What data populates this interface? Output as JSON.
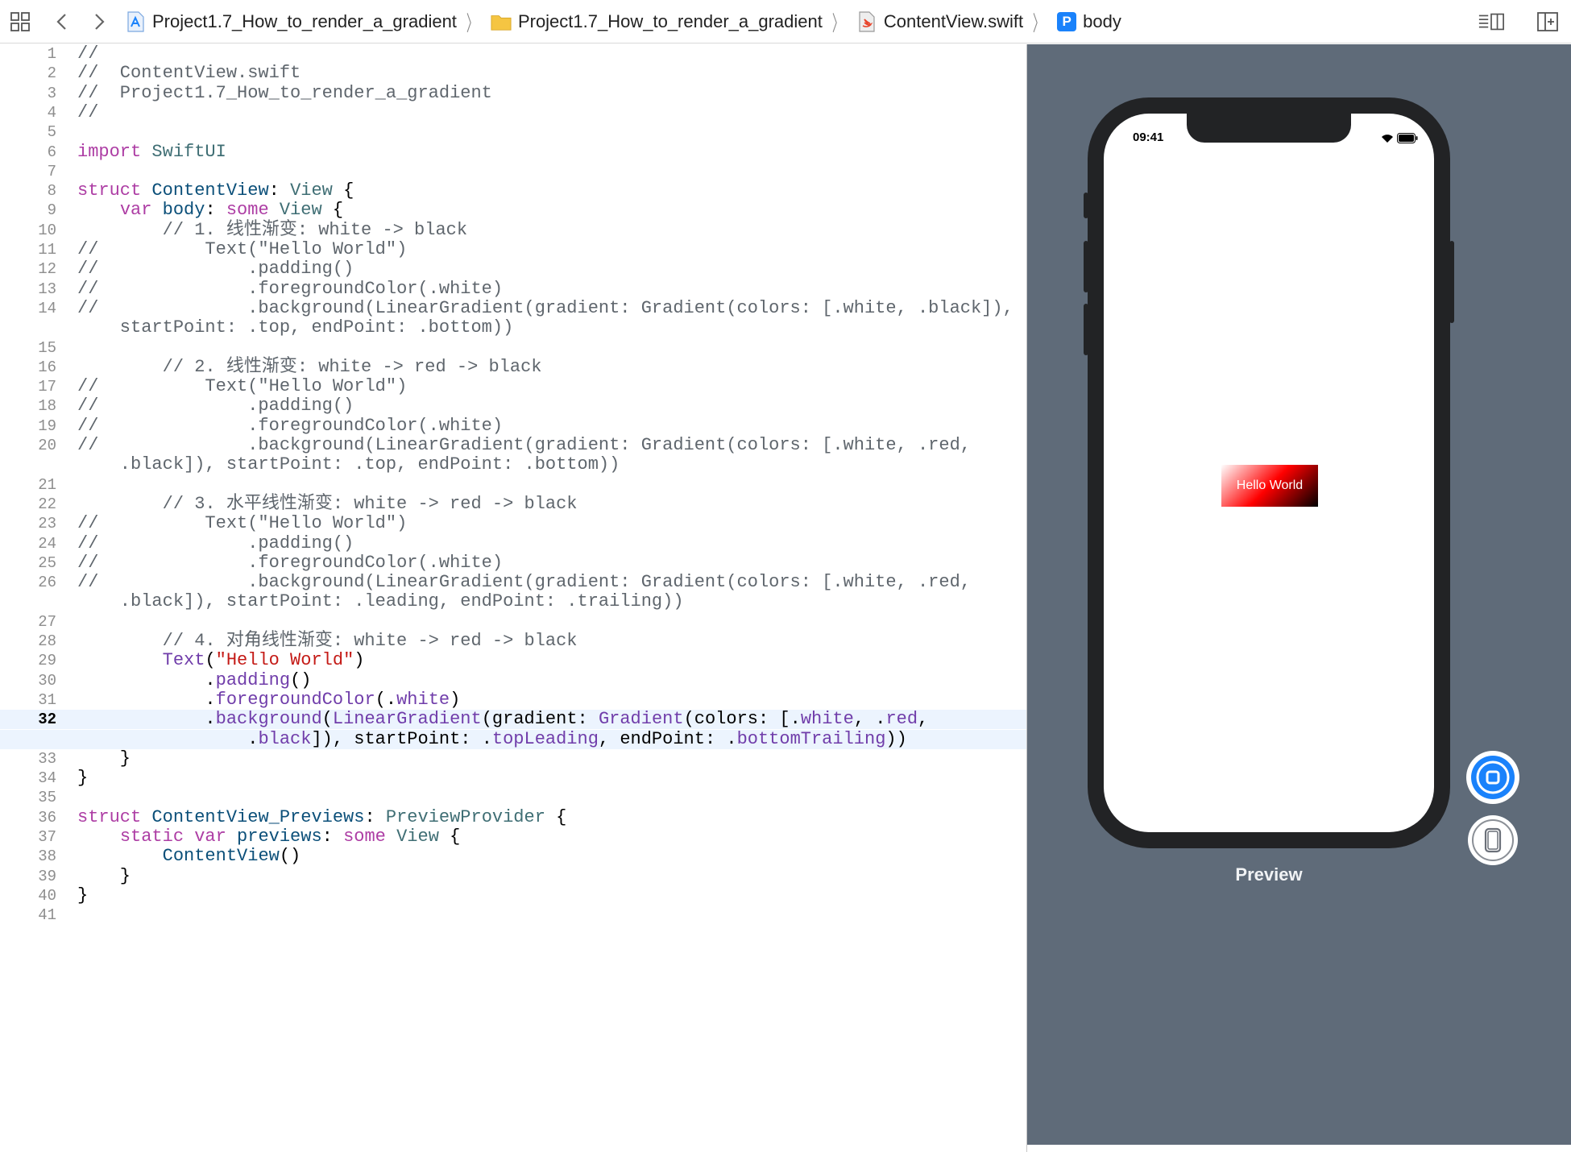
{
  "toolbar": {
    "breadcrumbs": [
      {
        "label": "Project1.7_How_to_render_a_gradient",
        "icon": "app-project-icon"
      },
      {
        "label": "Project1.7_How_to_render_a_gradient",
        "icon": "folder-icon"
      },
      {
        "label": "ContentView.swift",
        "icon": "swift-file-icon"
      },
      {
        "label": "body",
        "icon": "property-p-icon",
        "badge": "P"
      }
    ],
    "colors": {
      "accent": "#1a82fb",
      "folder": "#f5c542"
    }
  },
  "editor": {
    "current_line": 32,
    "lines": [
      {
        "n": "1",
        "t": "//"
      },
      {
        "n": "2",
        "t": "//  ContentView.swift"
      },
      {
        "n": "3",
        "t": "//  Project1.7_How_to_render_a_gradient"
      },
      {
        "n": "4",
        "t": "//"
      },
      {
        "n": "5",
        "t": ""
      },
      {
        "n": "6",
        "t": "import SwiftUI"
      },
      {
        "n": "7",
        "t": ""
      },
      {
        "n": "8",
        "t": "struct ContentView: View {"
      },
      {
        "n": "9",
        "t": "    var body: some View {"
      },
      {
        "n": "10",
        "t": "        // 1. 线性渐变: white -> black"
      },
      {
        "n": "11",
        "t": "//          Text(\"Hello World\")"
      },
      {
        "n": "12",
        "t": "//              .padding()"
      },
      {
        "n": "13",
        "t": "//              .foregroundColor(.white)"
      },
      {
        "n": "14",
        "t": "//              .background(LinearGradient(gradient: Gradient(colors: [.white, .black]),"
      },
      {
        "n": "",
        "t": "    startPoint: .top, endPoint: .bottom))"
      },
      {
        "n": "15",
        "t": ""
      },
      {
        "n": "16",
        "t": "        // 2. 线性渐变: white -> red -> black"
      },
      {
        "n": "17",
        "t": "//          Text(\"Hello World\")"
      },
      {
        "n": "18",
        "t": "//              .padding()"
      },
      {
        "n": "19",
        "t": "//              .foregroundColor(.white)"
      },
      {
        "n": "20",
        "t": "//              .background(LinearGradient(gradient: Gradient(colors: [.white, .red,"
      },
      {
        "n": "",
        "t": "    .black]), startPoint: .top, endPoint: .bottom))"
      },
      {
        "n": "21",
        "t": ""
      },
      {
        "n": "22",
        "t": "        // 3. 水平线性渐变: white -> red -> black"
      },
      {
        "n": "23",
        "t": "//          Text(\"Hello World\")"
      },
      {
        "n": "24",
        "t": "//              .padding()"
      },
      {
        "n": "25",
        "t": "//              .foregroundColor(.white)"
      },
      {
        "n": "26",
        "t": "//              .background(LinearGradient(gradient: Gradient(colors: [.white, .red,"
      },
      {
        "n": "",
        "t": "    .black]), startPoint: .leading, endPoint: .trailing))"
      },
      {
        "n": "27",
        "t": ""
      },
      {
        "n": "28",
        "t": "        // 4. 对角线性渐变: white -> red -> black"
      },
      {
        "n": "29",
        "t": "        Text(\"Hello World\")"
      },
      {
        "n": "30",
        "t": "            .padding()"
      },
      {
        "n": "31",
        "t": "            .foregroundColor(.white)"
      },
      {
        "n": "32",
        "t": "            .background(LinearGradient(gradient: Gradient(colors: [.white, .red,"
      },
      {
        "n": "",
        "t": "                .black]), startPoint: .topLeading, endPoint: .bottomTrailing))"
      },
      {
        "n": "33",
        "t": "    }"
      },
      {
        "n": "34",
        "t": "}"
      },
      {
        "n": "35",
        "t": ""
      },
      {
        "n": "36",
        "t": "struct ContentView_Previews: PreviewProvider {"
      },
      {
        "n": "37",
        "t": "    static var previews: some View {"
      },
      {
        "n": "38",
        "t": "        ContentView()"
      },
      {
        "n": "39",
        "t": "    }"
      },
      {
        "n": "40",
        "t": "}"
      },
      {
        "n": "41",
        "t": ""
      }
    ]
  },
  "preview": {
    "status_time": "09:41",
    "hello_text": "Hello World",
    "label": "Preview",
    "gradient_colors": [
      "#ffffff",
      "#ff0000",
      "#000000"
    ],
    "background_color": "#5f6b79"
  }
}
